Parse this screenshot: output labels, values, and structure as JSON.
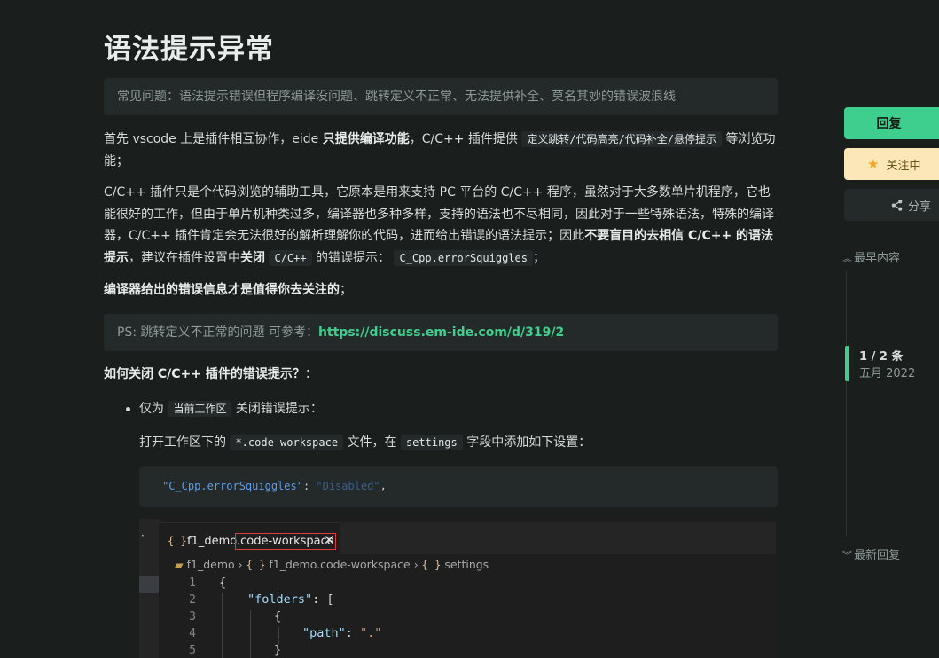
{
  "post": {
    "title": "语法提示异常",
    "faq": "常见问题：语法提示错误但程序编译没问题、跳转定义不正常、无法提供补全、莫名其妙的错误波浪线",
    "p1": {
      "a": "首先 vscode 上是插件相互协作，eide ",
      "b": "只提供编译功能",
      "c": "，C/C++ 插件提供 ",
      "code": "定义跳转/代码高亮/代码补全/悬停提示",
      "d": " 等浏览功能；"
    },
    "p2": {
      "a": "C/C++ 插件只是个代码浏览的辅助工具，它原本是用来支持 PC 平台的 C/C++ 程序，虽然对于大多数单片机程序，它也能很好的工作，但由于单片机种类过多，编译器也多种多样，支持的语法也不尽相同，因此对于一些特殊语法，特殊的编译器，C/C++ 插件肯定会无法很好的解析理解你的代码，进而给出错误的语法提示；因此",
      "b": "不要盲目的去相信 C/C++ 的语法提示",
      "c": "，建议在插件设置中",
      "d": "关闭",
      "code1": "C/C++",
      "e": " 的错误提示：",
      "code2": "C_Cpp.errorSquiggles",
      "f": "；"
    },
    "p3": "编译器给出的错误信息才是值得你去关注的",
    "p3_end": "；",
    "ps": {
      "label": "PS: 跳转定义不正常的问题 可参考：",
      "link": "https://discuss.em-ide.com/d/319/2"
    },
    "h_close": "如何关闭 C/C++ 插件的错误提示？",
    "h_close_end": "：",
    "li1": {
      "a": "仅为 ",
      "code": "当前工作区",
      "b": " 关闭错误提示："
    },
    "li1_desc": {
      "a": "打开工作区下的 ",
      "code1": "*.code-workspace",
      "b": " 文件，在 ",
      "code2": "settings",
      "c": " 字段中添加如下设置："
    },
    "code_snippet": {
      "key": "\"C_Cpp.errorSquiggles\"",
      "colon": ": ",
      "value": "\"Disabled\"",
      "comma": ","
    }
  },
  "vscode": {
    "dot": "·",
    "tab_icon": "{ }",
    "tab_name_a": "f1_demo",
    "tab_name_b": ".code-workspace",
    "tab_close": "✕",
    "crumb1": "f1_demo",
    "crumb_sep": "›",
    "crumb2_icon": "{ }",
    "crumb2": "f1_demo.code-workspace",
    "crumb3_icon": "{ }",
    "crumb3": "settings",
    "lines": [
      {
        "n": "1",
        "t": "{"
      },
      {
        "n": "2",
        "k": "\"folders\"",
        "t": ": ["
      },
      {
        "n": "3",
        "t": "{"
      },
      {
        "n": "4",
        "k": "\"path\"",
        "t": ": ",
        "s": "\".\""
      },
      {
        "n": "5",
        "t": "}"
      }
    ]
  },
  "sidebar": {
    "reply": "回复",
    "follow": "关注中",
    "share": "分享",
    "earliest": "最早内容",
    "count": "1 / 2 条",
    "date": "五月 2022",
    "latest": "最新回复"
  },
  "colors": {
    "accent": "#3ecf8e",
    "follow_bg": "#fbe7b8",
    "star": "#f0a726",
    "bg": "#1a1f1e",
    "panel": "#232a29"
  }
}
